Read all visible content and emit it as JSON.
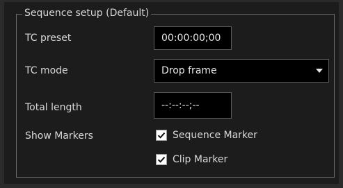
{
  "group": {
    "title": "Sequence setup (Default)"
  },
  "tc_preset": {
    "label": "TC preset",
    "value": "00:00:00;00"
  },
  "tc_mode": {
    "label": "TC mode",
    "value": "Drop frame"
  },
  "total_length": {
    "label": "Total length",
    "value": "--:--:--;--"
  },
  "show_markers": {
    "label": "Show Markers",
    "sequence_marker": {
      "label": "Sequence Marker",
      "checked": true
    },
    "clip_marker": {
      "label": "Clip Marker",
      "checked": true
    }
  }
}
